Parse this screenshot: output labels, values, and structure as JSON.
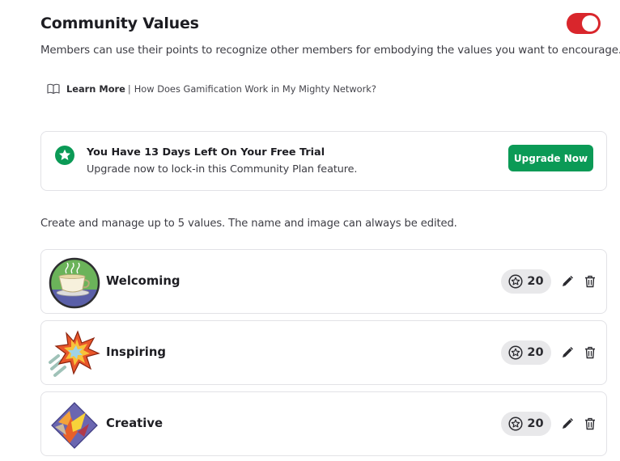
{
  "header": {
    "title": "Community Values",
    "toggle_on": true,
    "toggle_color": "#d9262c"
  },
  "subtitle": "Members can use their points to recognize other members for embodying the values you want to encourage.",
  "learn_more": {
    "icon": "book-icon",
    "link_label": "Learn More",
    "separator": "|",
    "question": "How Does Gamification Work in My Mighty Network?"
  },
  "trial": {
    "icon": "star-icon",
    "title": "You Have 13 Days Left On Your Free Trial",
    "text": "Upgrade now to lock-in this Community Plan feature.",
    "button_label": "Upgrade Now",
    "button_color": "#0b9a56"
  },
  "manage_text": "Create and manage up to 5 values. The name and image can always be edited.",
  "values": [
    {
      "name": "Welcoming",
      "points": "20",
      "image": "coffee-cup-image"
    },
    {
      "name": "Inspiring",
      "points": "20",
      "image": "starburst-image"
    },
    {
      "name": "Creative",
      "points": "20",
      "image": "paint-diamond-image"
    }
  ]
}
